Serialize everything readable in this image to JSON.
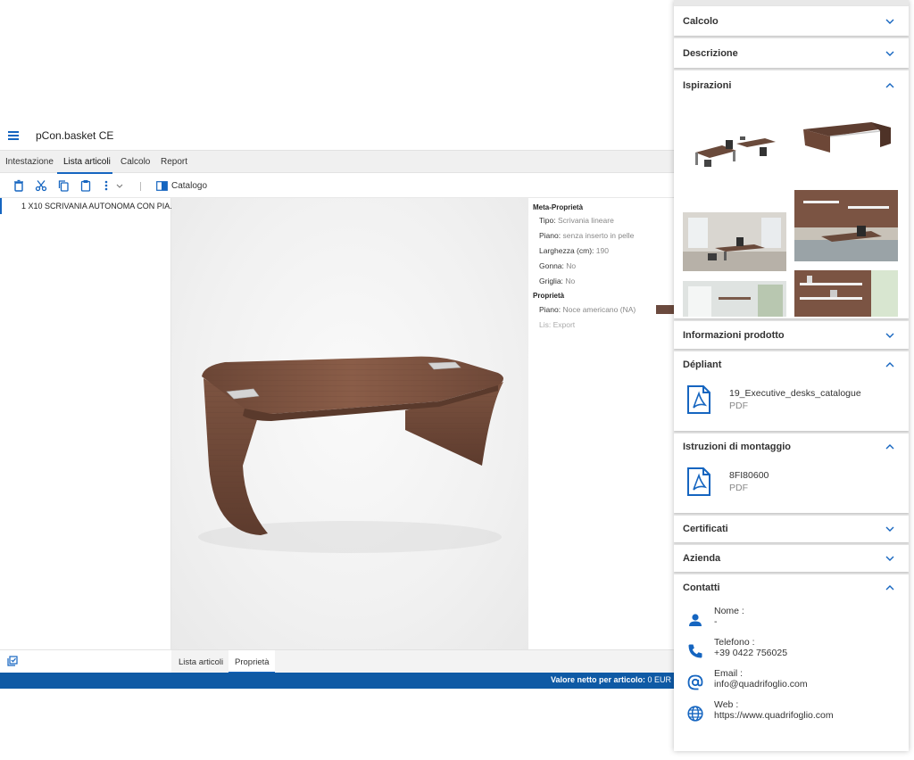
{
  "app": {
    "title": "pCon.basket CE",
    "tabs": [
      "Intestazione",
      "Lista articoli",
      "Calcolo",
      "Report"
    ],
    "active_tab": "Lista articoli",
    "toolbar": {
      "catalog_label": "Catalogo"
    },
    "article_list": [
      {
        "label": "1 X10 SCRIVANIA AUTONOMA CON PIA..."
      }
    ],
    "properties": {
      "meta_title": "Meta-Proprietà",
      "meta": [
        {
          "key": "Tipo:",
          "value": "Scrivania lineare"
        },
        {
          "key": "Piano:",
          "value": "senza inserto in pelle"
        },
        {
          "key": "Larghezza (cm):",
          "value": "190"
        },
        {
          "key": "Gonna:",
          "value": "No"
        },
        {
          "key": "Griglia:",
          "value": "No"
        }
      ],
      "props_title": "Proprietà",
      "props": [
        {
          "key": "Piano:",
          "value": "Noce americano (NA)"
        }
      ],
      "disabled_row": "Lis: Export",
      "swatch_color": "#6b4a3e"
    },
    "bottom_tabs": [
      "Lista articoli",
      "Proprietà"
    ],
    "active_bottom_tab": "Proprietà",
    "status": {
      "label": "Valore netto per articolo:",
      "value": "0 EUR"
    },
    "accent_color": "#1565c0"
  },
  "panel": {
    "sections": {
      "calcolo": "Calcolo",
      "descrizione": "Descrizione",
      "ispirazioni": "Ispirazioni",
      "informazioni": "Informazioni prodotto",
      "depliant": "Dépliant",
      "istruzioni": "Istruzioni di montaggio",
      "certificati": "Certificati",
      "azienda": "Azienda",
      "contatti": "Contatti"
    },
    "depliant_file": {
      "name": "19_Executive_desks_catalogue",
      "type": "PDF"
    },
    "istruzioni_file": {
      "name": "8FI80600",
      "type": "PDF"
    },
    "contacts": [
      {
        "label": "Nome :",
        "value": "-",
        "icon": "person-icon"
      },
      {
        "label": "Telefono :",
        "value": "+39 0422 756025",
        "icon": "phone-icon"
      },
      {
        "label": "Email :",
        "value": "info@quadrifoglio.com",
        "icon": "at-icon"
      },
      {
        "label": "Web :",
        "value": "https://www.quadrifoglio.com",
        "icon": "globe-icon"
      }
    ],
    "icon_color": "#1565c0"
  }
}
